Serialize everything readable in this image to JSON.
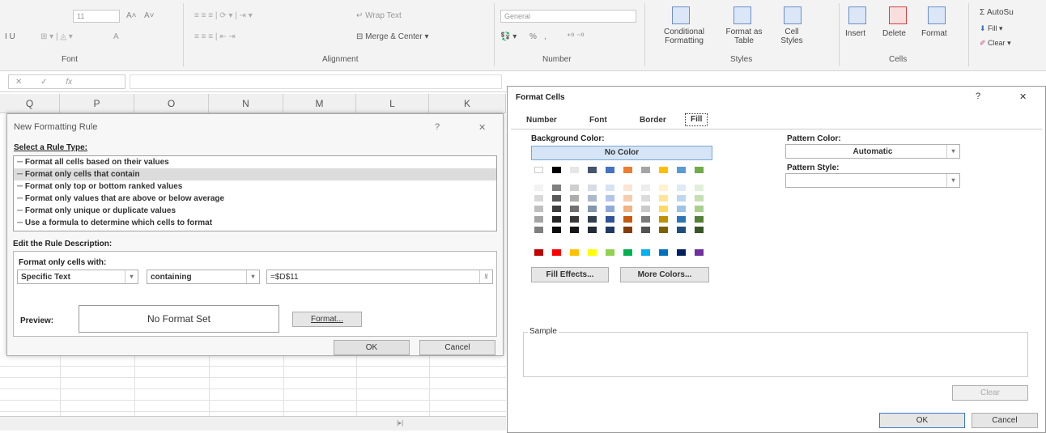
{
  "ribbon": {
    "font_size": "11",
    "font_grow": "A˄",
    "font_shrink": "A˅",
    "bold_italic": "I  U",
    "font_color": "A",
    "wrap_text": "Wrap Text",
    "merge_center": "Merge & Center",
    "number_format": "General",
    "percent": "%",
    "comma": ",",
    "conditional_formatting": "Conditional Formatting",
    "format_as_table": "Format as Table",
    "cell_styles": "Cell Styles",
    "insert": "Insert",
    "delete": "Delete",
    "format": "Format",
    "autosum": "AutoSu",
    "fill": "Fill",
    "clear": "Clear",
    "groups": {
      "font": "Font",
      "alignment": "Alignment",
      "number": "Number",
      "styles": "Styles",
      "cells": "Cells"
    }
  },
  "formula_bar": {
    "cancel": "✕",
    "enter": "✓",
    "fx": "fx"
  },
  "columns": [
    "Q",
    "P",
    "O",
    "N",
    "M",
    "L",
    "K"
  ],
  "new_rule": {
    "title": "New Formatting Rule",
    "help": "?",
    "close": "✕",
    "select_rule_type": "Select a Rule Type:",
    "rule_types": [
      "─ Format all cells based on their values",
      "─ Format only cells that contain",
      "─ Format only top or bottom ranked values",
      "─ Format only values that are above or below average",
      "─ Format only unique or duplicate values",
      "─ Use a formula to determine which cells to format"
    ],
    "selected_index": 1,
    "edit_desc": "Edit the Rule Description:",
    "format_only_with": "Format only cells with:",
    "condition_type": "Specific Text",
    "operator": "containing",
    "value": "=$D$11",
    "preview_label": "Preview:",
    "preview_text": "No Format Set",
    "format_button": "Format...",
    "ok": "OK",
    "cancel": "Cancel"
  },
  "format_cells": {
    "title": "Format Cells",
    "help": "?",
    "close": "✕",
    "tabs": [
      "Number",
      "Font",
      "Border",
      "Fill"
    ],
    "active_tab": "Fill",
    "background_color": "Background Color:",
    "no_color": "No Color",
    "pattern_color_label": "Pattern Color:",
    "pattern_color_value": "Automatic",
    "pattern_style_label": "Pattern Style:",
    "fill_effects": "Fill Effects...",
    "more_colors": "More Colors...",
    "sample": "Sample",
    "clear": "Clear",
    "ok": "OK",
    "cancel": "Cancel",
    "theme_colors": [
      "#ffffff",
      "#000000",
      "#e7e6e6",
      "#44546a",
      "#4472c4",
      "#ed7d31",
      "#a5a5a5",
      "#ffc000",
      "#5b9bd5",
      "#70ad47"
    ],
    "tint_rows": [
      [
        "#f2f2f2",
        "#7f7f7f",
        "#d0cece",
        "#d6dce4",
        "#d9e2f3",
        "#fbe5d5",
        "#ededed",
        "#fff2cc",
        "#deebf6",
        "#e2efd9"
      ],
      [
        "#d8d8d8",
        "#595959",
        "#aeabab",
        "#adb9ca",
        "#b4c6e7",
        "#f7cbac",
        "#dbdbdb",
        "#fee599",
        "#bdd7ee",
        "#c5e0b3"
      ],
      [
        "#bfbfbf",
        "#3f3f3f",
        "#757070",
        "#8496b0",
        "#8eaadb",
        "#f4b183",
        "#c9c9c9",
        "#ffd965",
        "#9dc3e6",
        "#a8d08d"
      ],
      [
        "#a5a5a5",
        "#262626",
        "#3a3838",
        "#323f4f",
        "#2f5496",
        "#c55a11",
        "#7b7b7b",
        "#bf9000",
        "#2e75b5",
        "#538135"
      ],
      [
        "#7f7f7f",
        "#0c0c0c",
        "#171616",
        "#222a35",
        "#1f3864",
        "#833c0b",
        "#525252",
        "#7f6000",
        "#1e4e79",
        "#375623"
      ]
    ],
    "standard_colors": [
      "#c00000",
      "#ff0000",
      "#ffc000",
      "#ffff00",
      "#92d050",
      "#00b050",
      "#00b0f0",
      "#0070c0",
      "#002060",
      "#7030a0"
    ]
  }
}
